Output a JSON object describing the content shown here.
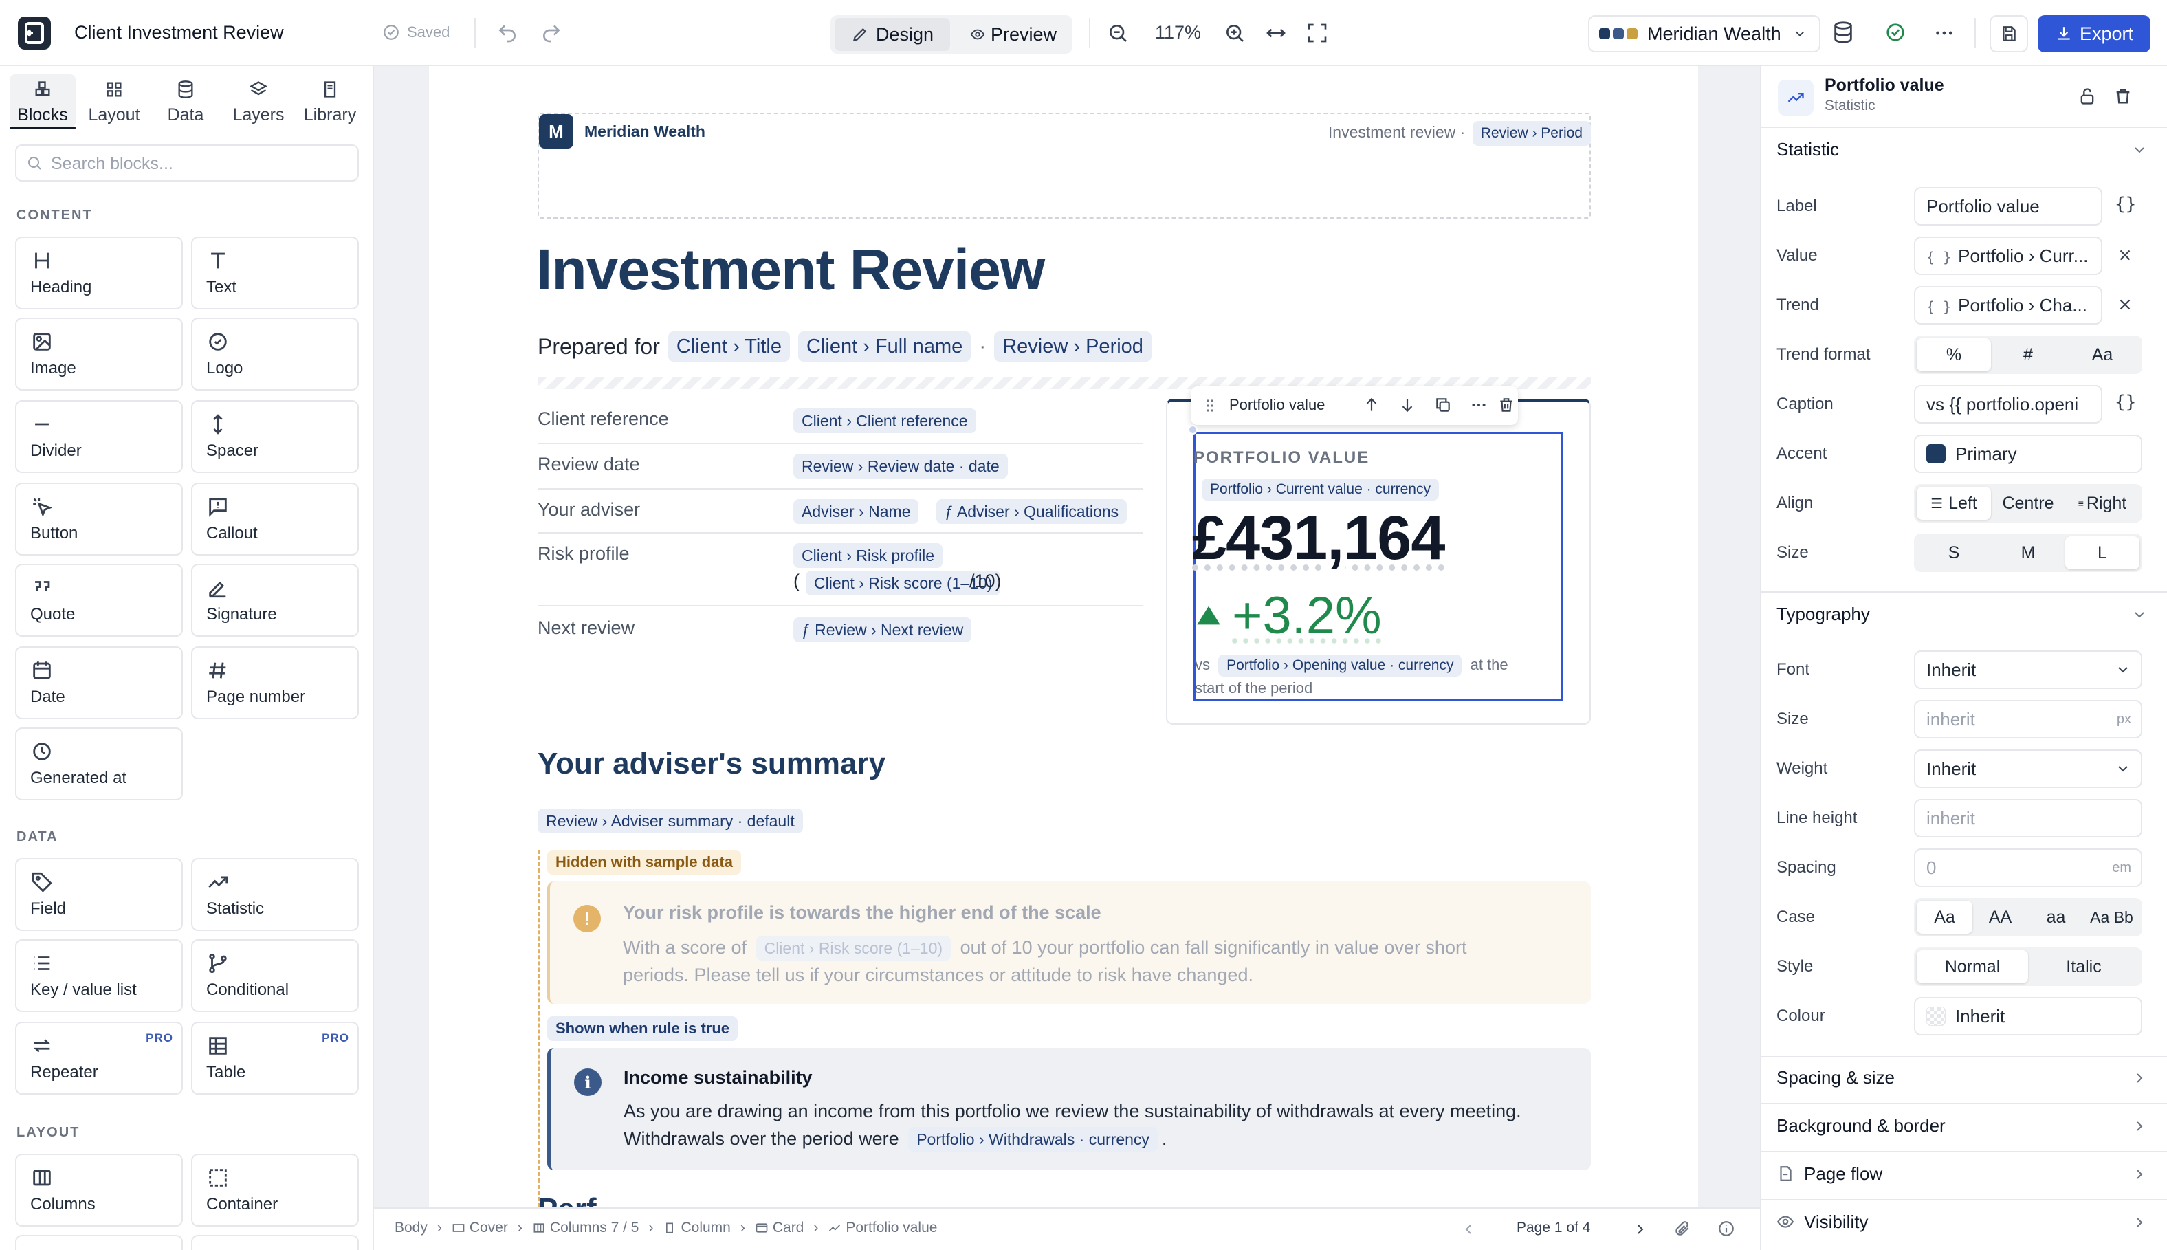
{
  "topbar": {
    "doc_title": "Client Investment Review",
    "saved_label": "Saved",
    "design_label": "Design",
    "preview_label": "Preview",
    "zoom": "117%",
    "theme_name": "Meridian Wealth",
    "export_label": "Export"
  },
  "left": {
    "tabs": [
      "Blocks",
      "Layout",
      "Data",
      "Layers",
      "Library"
    ],
    "search_placeholder": "Search blocks...",
    "sections": {
      "content": "CONTENT",
      "data": "DATA",
      "layout": "LAYOUT"
    },
    "content_blocks": [
      "Heading",
      "Text",
      "Image",
      "Logo",
      "Divider",
      "Spacer",
      "Button",
      "Callout",
      "Quote",
      "Signature",
      "Date",
      "Page number",
      "Generated at"
    ],
    "data_blocks": [
      "Field",
      "Statistic",
      "Key / value list",
      "Conditional",
      "Repeater",
      "Table"
    ],
    "layout_blocks": [
      "Columns",
      "Container"
    ],
    "pro_badge": "PRO"
  },
  "doc": {
    "logo_letter": "M",
    "brand": "Meridian Wealth",
    "header_right": "Investment review ·",
    "header_chip": "Review › Period",
    "title": "Investment Review",
    "prepared_for": "Prepared for",
    "prepared_chips": [
      "Client › Title",
      "Client › Full name",
      "Review › Period"
    ],
    "dot": "·",
    "kv": [
      {
        "key": "Client reference",
        "chips": [
          "Client › Client reference"
        ]
      },
      {
        "key": "Review date",
        "chips": [
          "Review › Review date · date"
        ]
      },
      {
        "key": "Your adviser",
        "chips": [
          "Adviser › Name",
          "ƒ Adviser › Qualifications"
        ]
      },
      {
        "key": "Risk profile",
        "chips": [
          "Client › Risk profile",
          "Client › Risk score (1–10)"
        ],
        "open": "(",
        "close": "/10)"
      },
      {
        "key": "Next review",
        "chips": [
          "ƒ Review › Next review"
        ]
      }
    ],
    "stat_toolbar_label": "Portfolio value",
    "stat_label": "PORTFOLIO VALUE",
    "stat_value_chip": "Portfolio › Current value · currency",
    "stat_value": "£431,164",
    "stat_trend": "+3.2%",
    "stat_caption_pre": "vs",
    "stat_caption_chip": "Portfolio › Opening value · currency",
    "stat_caption_post": "at the",
    "stat_caption_line2": "start of the period",
    "summary_heading": "Your adviser's summary",
    "summary_chip": "Review › Adviser summary · default",
    "hidden_badge": "Hidden with sample data",
    "warn_title": "Your risk profile is towards the higher end of the scale",
    "warn_pre": "With a score of",
    "warn_chip": "Client › Risk score (1–10)",
    "warn_post": "out of 10 your portfolio can fall significantly in value over short",
    "warn_line2": "periods. Please tell us if your circumstances or attitude to risk have changed.",
    "shown_badge": "Shown when rule is true",
    "info_title": "Income sustainability",
    "info_line1": "As you are drawing an income from this portfolio we review the sustainability of withdrawals at every meeting.",
    "info_pre": "Withdrawals over the period were",
    "info_chip": "Portfolio › Withdrawals · currency",
    "info_post": ".",
    "cut_heading": "Perf"
  },
  "status": {
    "crumbs": [
      "Body",
      "Cover",
      "Columns 7 / 5",
      "Column",
      "Card",
      "Portfolio value"
    ],
    "page": "Page 1 of 4"
  },
  "right": {
    "title": "Portfolio value",
    "subtitle": "Statistic",
    "statistic_section": "Statistic",
    "label_label": "Label",
    "label_value": "Portfolio value",
    "value_label": "Value",
    "value_value": "Portfolio › Curr...",
    "trend_label": "Trend",
    "trend_value": "Portfolio › Cha...",
    "trend_format_label": "Trend format",
    "trend_format_opts": [
      "%",
      "#",
      "Aa"
    ],
    "caption_label": "Caption",
    "caption_value": "vs {{ portfolio.openi",
    "accent_label": "Accent",
    "accent_value": "Primary",
    "align_label": "Align",
    "align_opts": [
      "Left",
      "Centre",
      "Right"
    ],
    "size_label": "Size",
    "size_opts": [
      "S",
      "M",
      "L"
    ],
    "typography_section": "Typography",
    "font_label": "Font",
    "font_value": "Inherit",
    "tsize_label": "Size",
    "tsize_placeholder": "inherit",
    "tsize_unit": "px",
    "weight_label": "Weight",
    "weight_value": "Inherit",
    "lineheight_label": "Line height",
    "lineheight_placeholder": "inherit",
    "spacing_label": "Spacing",
    "spacing_placeholder": "0",
    "spacing_unit": "em",
    "case_label": "Case",
    "case_opts": [
      "Aa",
      "AA",
      "aa",
      "Aa Bb"
    ],
    "style_label": "Style",
    "style_opts": [
      "Normal",
      "Italic"
    ],
    "colour_label": "Colour",
    "colour_value": "Inherit",
    "spacing_size_section": "Spacing & size",
    "bg_section": "Background & border",
    "pageflow_section": "Page flow",
    "visibility_section": "Visibility"
  },
  "colors": {
    "primary": "#1e3a5f",
    "accent_blue": "#2f56d6",
    "trend_green": "#1f8a4c",
    "warn": "#e3b062",
    "info": "#3b5a8a"
  }
}
